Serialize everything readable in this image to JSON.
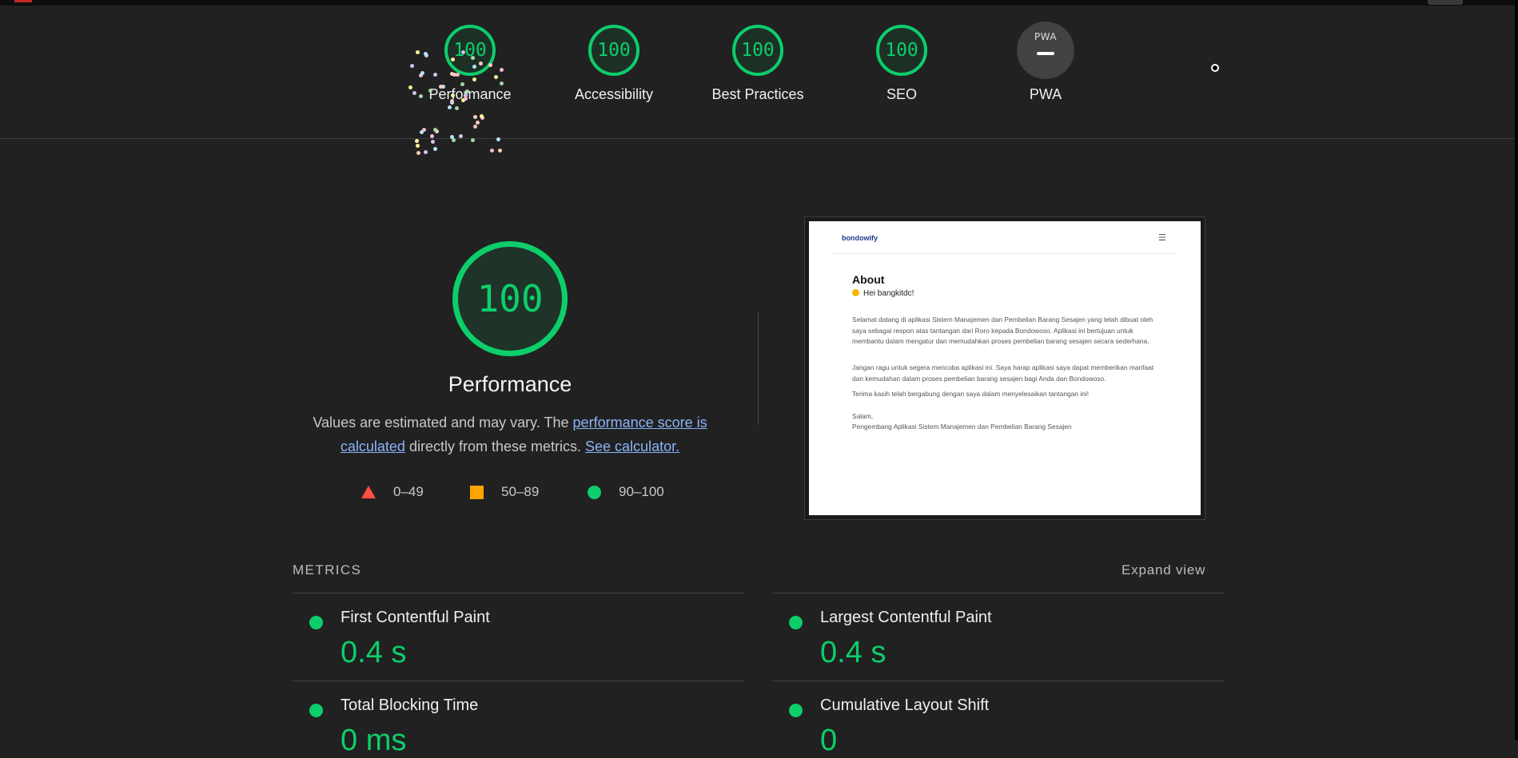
{
  "colors": {
    "pass": "#0cce6b",
    "average": "#ffa400",
    "fail": "#ff4e42",
    "link": "#8ab4f8",
    "background": "#212121"
  },
  "header": {
    "gauges": [
      {
        "score": "100",
        "label": "Performance"
      },
      {
        "score": "100",
        "label": "Accessibility"
      },
      {
        "score": "100",
        "label": "Best Practices"
      },
      {
        "score": "100",
        "label": "SEO"
      }
    ],
    "pwa": {
      "badge_text": "PWA",
      "label": "PWA"
    }
  },
  "performance": {
    "score": "100",
    "title": "Performance",
    "desc_prefix": "Values are estimated and may vary. The ",
    "desc_link1": "performance score is calculated",
    "desc_middle": " directly from these metrics. ",
    "desc_link2": "See calculator.",
    "legend": [
      {
        "icon": "triangle-icon",
        "range": "0–49"
      },
      {
        "icon": "square-icon",
        "range": "50–89"
      },
      {
        "icon": "circle-icon",
        "range": "90–100"
      }
    ]
  },
  "screenshot": {
    "brand": "bondowify",
    "heading": "About",
    "greeting": "Hei bangkitdc!",
    "paragraphs": [
      "Selamat datang di aplikasi Sistem Manajemen dan Pembelian Barang Sesajen yang telah dibuat oleh saya sebagai respon atas tantangan dari Roro kepada Bondowoso. Aplikasi ini bertujuan untuk membantu dalam mengatur dan memudahkan proses pembelian barang sesajen secara sederhana.",
      "Jangan ragu untuk segera mencoba aplikasi ini. Saya harap aplikasi saya dapat memberikan manfaat dan kemudahan dalam proses pembelian barang sesajen bagi Anda dan Bondowoso.",
      "Terima kasih telah bergabung dengan saya dalam menyelesaikan tantangan ini!",
      "Salam,",
      "Pengembang Aplikasi Sistem Manajemen dan Pembelian Barang Sesajen"
    ]
  },
  "metrics": {
    "heading": "METRICS",
    "expand_label": "Expand view",
    "items": [
      {
        "label": "First Contentful Paint",
        "value": "0.4 s"
      },
      {
        "label": "Largest Contentful Paint",
        "value": "0.4 s"
      },
      {
        "label": "Total Blocking Time",
        "value": "0 ms"
      },
      {
        "label": "Cumulative Layout Shift",
        "value": "0"
      }
    ]
  }
}
